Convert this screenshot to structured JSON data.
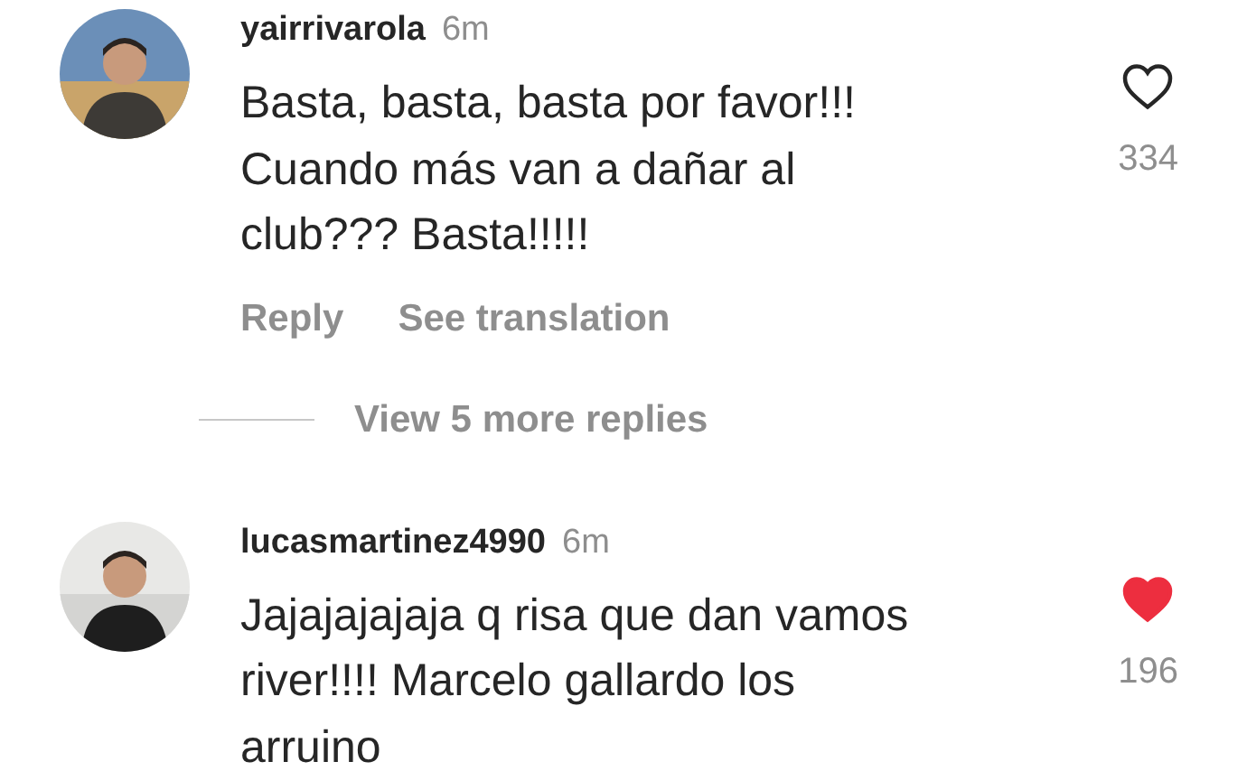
{
  "comments": [
    {
      "username": "yairrivarola",
      "time": "6m",
      "text": "Basta, basta, basta por favor!!!\nCuando más van a dañar al\nclub??? Basta!!!!!",
      "liked": false,
      "likes": "334",
      "actions": [
        "Reply",
        "See translation"
      ],
      "more_replies": "View 5 more replies"
    },
    {
      "username": "lucasmartinez4990",
      "time": "6m",
      "text": "Jajajajajaja q risa que dan vamos\nriver!!!! Marcelo gallardo los\narruino",
      "liked": true,
      "likes": "196"
    }
  ]
}
